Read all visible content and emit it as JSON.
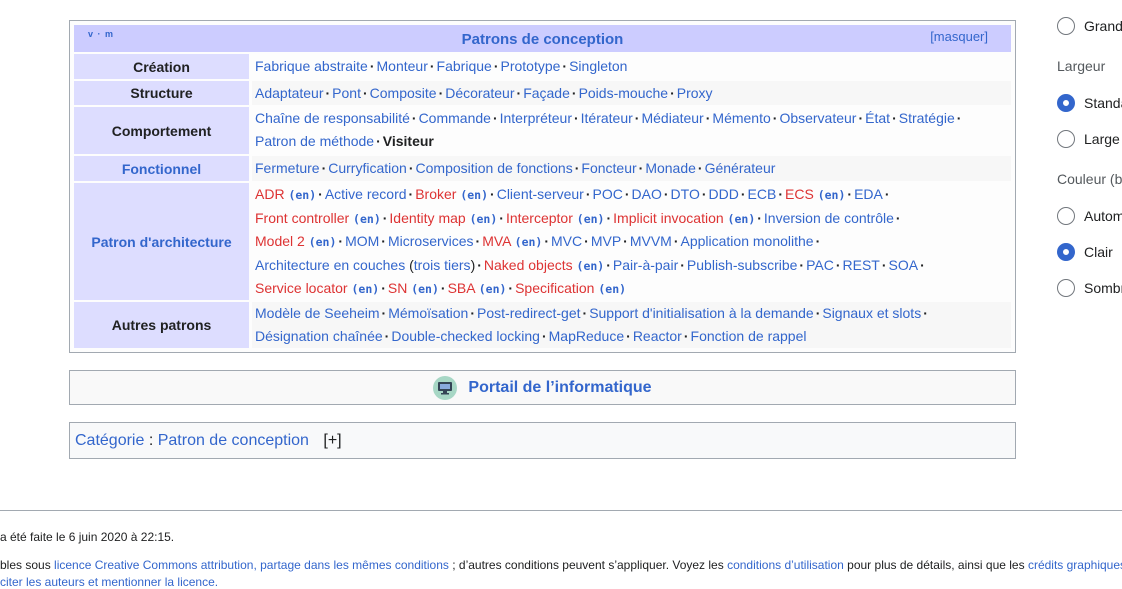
{
  "navbox": {
    "vm": "v · m",
    "title": "Patrons de conception",
    "hide": "[masquer]",
    "groups": {
      "creation": "Création",
      "structure": "Structure",
      "comportement": "Comportement",
      "fonctionnel": "Fonctionnel",
      "architecture": "Patron d'architecture",
      "autres": "Autres patrons"
    },
    "creation": [
      "Fabrique abstraite",
      "Monteur",
      "Fabrique",
      "Prototype",
      "Singleton"
    ],
    "structure": [
      "Adaptateur",
      "Pont",
      "Composite",
      "Décorateur",
      "Façade",
      "Poids-mouche",
      "Proxy"
    ],
    "comportement": [
      "Chaîne de responsabilité",
      "Commande",
      "Interpréteur",
      "Itérateur",
      "Médiateur",
      "Mémento",
      "Observateur",
      "État",
      "Stratégie",
      "Patron de méthode",
      "Visiteur"
    ],
    "fonctionnel": [
      "Fermeture",
      "Curryfication",
      "Composition de fonctions",
      "Foncteur",
      "Monade",
      "Générateur"
    ],
    "architecture": {
      "adr": "ADR",
      "active_record": "Active record",
      "broker": "Broker",
      "client_serveur": "Client-serveur",
      "poc": "POC",
      "dao": "DAO",
      "dto": "DTO",
      "ddd": "DDD",
      "ecb": "ECB",
      "ecs": "ECS",
      "eda": "EDA",
      "front_controller": "Front controller",
      "identity_map": "Identity map",
      "interceptor": "Interceptor",
      "implicit_invocation": "Implicit invocation",
      "inversion": "Inversion de contrôle",
      "model2": "Model 2",
      "mom": "MOM",
      "microservices": "Microservices",
      "mva": "MVA",
      "mvc": "MVC",
      "mvp": "MVP",
      "mvvm": "MVVM",
      "monolithe": "Application monolithe",
      "couches": "Architecture en couches",
      "trois_tiers": "trois tiers",
      "naked": "Naked objects",
      "p2p": "Pair-à-pair",
      "pubsub": "Publish-subscribe",
      "pac": "PAC",
      "rest": "REST",
      "soa": "SOA",
      "service_locator": "Service locator",
      "sn": "SN",
      "sba": "SBA",
      "specification": "Specification",
      "en": "(en)"
    },
    "autres": [
      "Modèle de Seeheim",
      "Mémoïsation",
      "Post-redirect-get",
      "Support d'initialisation à la demande",
      "Signaux et slots",
      "Désignation chaînée",
      "Double-checked locking",
      "MapReduce",
      "Reactor",
      "Fonction de rappel"
    ]
  },
  "portal": {
    "label": "Portail de l’informatique"
  },
  "categories": {
    "label": "Catégorie",
    "item": "Patron de conception",
    "toggle": "[+]"
  },
  "footer": {
    "line1": "a été faite le 6 juin 2020 à 22:15.",
    "line2_a": "bles sous ",
    "line2_link1": "licence Creative Commons attribution, partage dans les mêmes conditions",
    "line2_b": " ; d’autres conditions peuvent s’appliquer. Voyez les ",
    "line2_link2": "conditions d’utilisation",
    "line2_c": " pour plus de détails, ainsi que les ",
    "line2_link3": "crédits graphiques",
    "line3": "citer les auteurs et mentionner la licence."
  },
  "sidebar": {
    "opt_grand": "Grand",
    "largeur": "Largeur",
    "opt_standard": "Standard",
    "opt_large": "Large",
    "couleur": "Couleur (b",
    "opt_auto": "Automatique",
    "opt_clair": "Clair",
    "opt_sombre": "Sombre"
  }
}
